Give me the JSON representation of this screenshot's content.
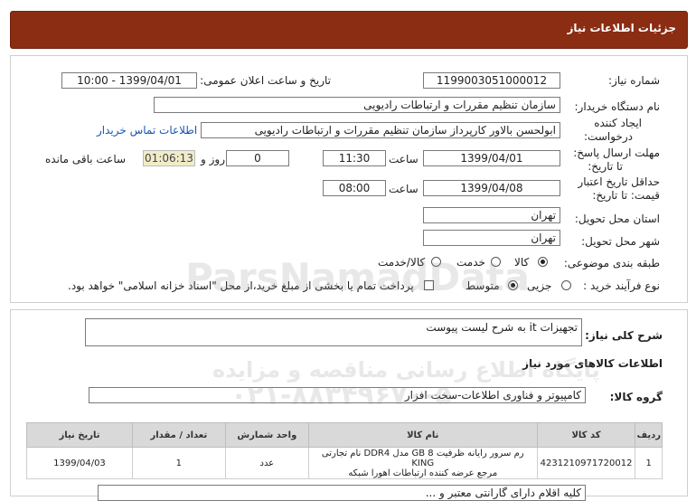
{
  "header": {
    "title": "جزئیات اطلاعات نیاز"
  },
  "fields": {
    "need_number_label": "شماره نیاز:",
    "need_number": "1199003051000012",
    "announce_label": "تاریخ و ساعت اعلان عمومی:",
    "announce_value": "1399/04/01 - 10:00",
    "buyer_label": "نام دستگاه خریدار:",
    "buyer_value": "سازمان تنظیم مقررات و ارتباطات رادیویی",
    "creator_label_1": "ایجاد کننده",
    "creator_label_2": "درخواست:",
    "creator_value": "ابولحسن  بالاور کارپرداز سازمان تنظیم مقررات و ارتباطات رادیویی",
    "contact_link": "اطلاعات تماس خریدار",
    "deadline_label_1": "مهلت ارسال پاسخ:",
    "deadline_label_2": "تا تاریخ:",
    "deadline_date": "1399/04/01",
    "time_label": "ساعت",
    "deadline_time": "11:30",
    "days_value": "0",
    "days_label": "روز و",
    "remaining_timer": "01:06:13",
    "remaining_label": "ساعت باقی مانده",
    "validity_label_1": "حداقل تاریخ اعتبار",
    "validity_label_2": "قیمت: تا تاریخ:",
    "validity_date": "1399/04/08",
    "validity_time": "08:00",
    "province_label": "استان محل تحویل:",
    "province_value": "تهران",
    "city_label": "شهر محل تحویل:",
    "city_value": "تهران",
    "category_label": "طبقه بندی موضوعی:",
    "category_options": [
      "کالا",
      "خدمت",
      "کالا/خدمت"
    ],
    "process_label": "نوع فرآیند خرید :",
    "process_options": [
      "جزیی",
      "متوسط"
    ],
    "payment_note": "پرداخت تمام یا بخشی از مبلغ خرید،از محل \"اسناد خزانه اسلامی\" خواهد بود."
  },
  "description": {
    "label": "شرح کلی نیاز:",
    "value": "تجهیزات it به شرح لیست پیوست"
  },
  "goods": {
    "section_title": "اطلاعات کالاهای مورد نیاز",
    "group_label": "گروه کالا:",
    "group_value": "کامپیوتر و فناوری اطلاعات-سخت افزار",
    "columns": [
      "ردیف",
      "کد کالا",
      "نام کالا",
      "واحد شمارش",
      "تعداد / مقدار",
      "تاریخ نیاز"
    ],
    "rows": [
      {
        "index": "1",
        "code": "4231210971720012",
        "name_line1": "رم سرور رایانه ظرفیت 8 GB مدل DDR4 نام تجارتی KING",
        "name_line2": "مرجع عرضه کننده ارتباطات اهورا شبکه",
        "unit": "عدد",
        "qty": "1",
        "date": "1399/04/03"
      }
    ]
  },
  "footer_fragment": "کلیه اقلام دارای گارانتی معتبر و ...",
  "watermark": {
    "brand": "ParsNamadData",
    "line1": "پایگاه اطلاع رسانی مناقصه و مزایده",
    "phone": "۰۲۱-۸۸۳۴۹۶۷۰-۵"
  },
  "colors": {
    "header_bg": "#8b2d13",
    "link": "#1a56b3",
    "timer_bg": "#f1ecc8"
  }
}
